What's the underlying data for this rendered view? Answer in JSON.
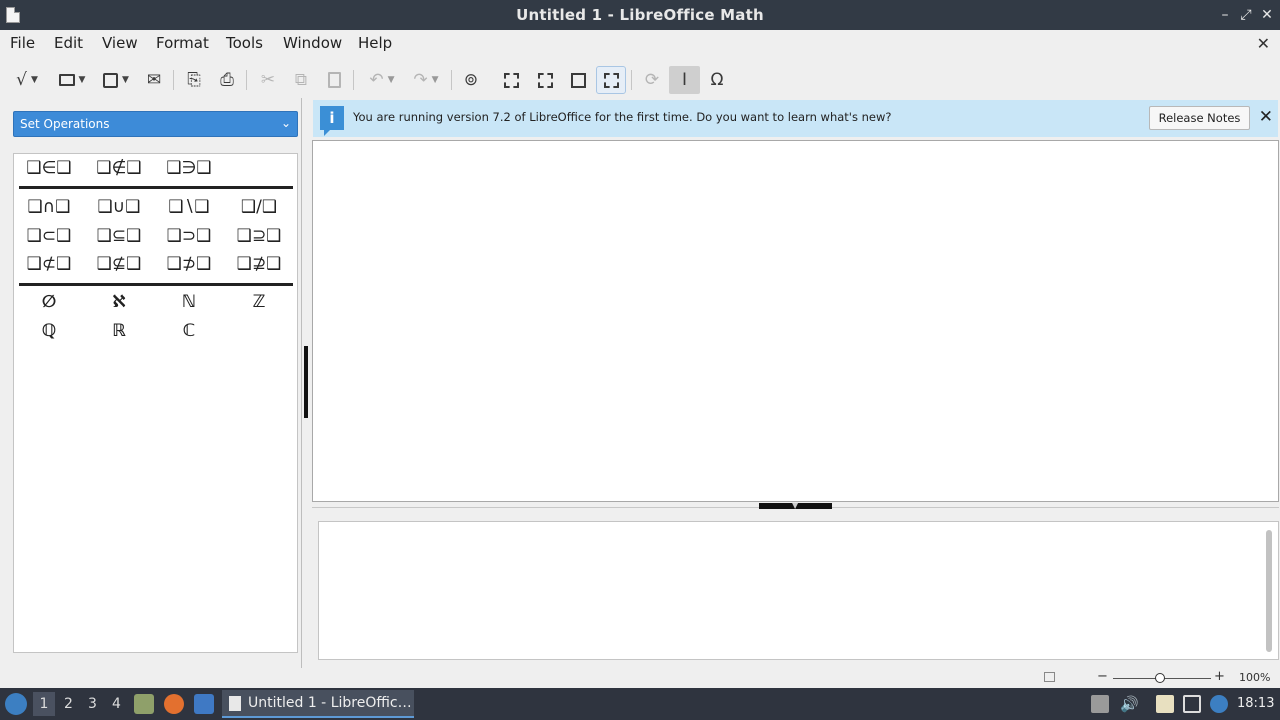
{
  "window": {
    "title": "Untitled 1 - LibreOffice Math",
    "minimize_glyph": "–",
    "restore_glyph": "⤢",
    "close_glyph": "✕"
  },
  "menubar": {
    "items": [
      "File",
      "Edit",
      "View",
      "Format",
      "Tools",
      "Window",
      "Help"
    ],
    "doc_close_glyph": "✕"
  },
  "toolbar": {
    "buttons": [
      {
        "name": "new-formula-button",
        "icon": "√"
      },
      {
        "name": "open-button",
        "icon": "📂"
      },
      {
        "name": "save-button",
        "icon": "💾"
      },
      {
        "name": "email-button",
        "icon": "✉"
      },
      {
        "name": "export-pdf-button",
        "icon": "⎘"
      },
      {
        "name": "print-button",
        "icon": "⎙"
      },
      {
        "name": "cut-button",
        "icon": "✂"
      },
      {
        "name": "copy-button",
        "icon": "⧉"
      },
      {
        "name": "paste-button",
        "icon": "📋"
      },
      {
        "name": "undo-button",
        "icon": "↶"
      },
      {
        "name": "redo-button",
        "icon": "↷"
      },
      {
        "name": "zoom-100-button",
        "icon": "⊚"
      },
      {
        "name": "zoom-in-button",
        "icon": "⬚"
      },
      {
        "name": "zoom-out-button",
        "icon": "⬚"
      },
      {
        "name": "show-all-button",
        "icon": "▢"
      },
      {
        "name": "formula-cursor-button",
        "icon": "⊡"
      },
      {
        "name": "update-button",
        "icon": "⟳"
      },
      {
        "name": "cursor-button",
        "icon": "I"
      },
      {
        "name": "symbols-button",
        "icon": "Ω"
      }
    ]
  },
  "elements_panel": {
    "category": "Set Operations",
    "row1": [
      "❑∈❑",
      "❑∉❑",
      "❑∋❑"
    ],
    "row2": [
      "❑∩❑",
      "❑∪❑",
      "❑∖❑",
      "❑/❑"
    ],
    "row3": [
      "❑⊂❑",
      "❑⊆❑",
      "❑⊃❑",
      "❑⊇❑"
    ],
    "row4": [
      "❑⊄❑",
      "❑⊈❑",
      "❑⊅❑",
      "❑⊉❑"
    ],
    "sets_row1": [
      "∅",
      "ℵ",
      "ℕ",
      "ℤ"
    ],
    "sets_row2": [
      "ℚ",
      "ℝ",
      "ℂ"
    ]
  },
  "infobar": {
    "message": "You are running version 7.2 of LibreOffice for the first time. Do you want to learn what's new?",
    "button": "Release Notes",
    "info_glyph": "i",
    "close_glyph": "✕"
  },
  "statusbar": {
    "zoom": "100%",
    "zoom_minus": "−",
    "zoom_plus": "+",
    "zoom_level_percent": 100
  },
  "taskbar": {
    "workspaces": [
      "1",
      "2",
      "3",
      "4"
    ],
    "active_workspace": "1",
    "task_label": "Untitled 1 - LibreOffic…",
    "clock": "18:13"
  },
  "colors": {
    "titlebar": "#323a45",
    "accent": "#3d8bd8",
    "infobar": "#c9e6f7",
    "taskbar": "#2f343f"
  }
}
